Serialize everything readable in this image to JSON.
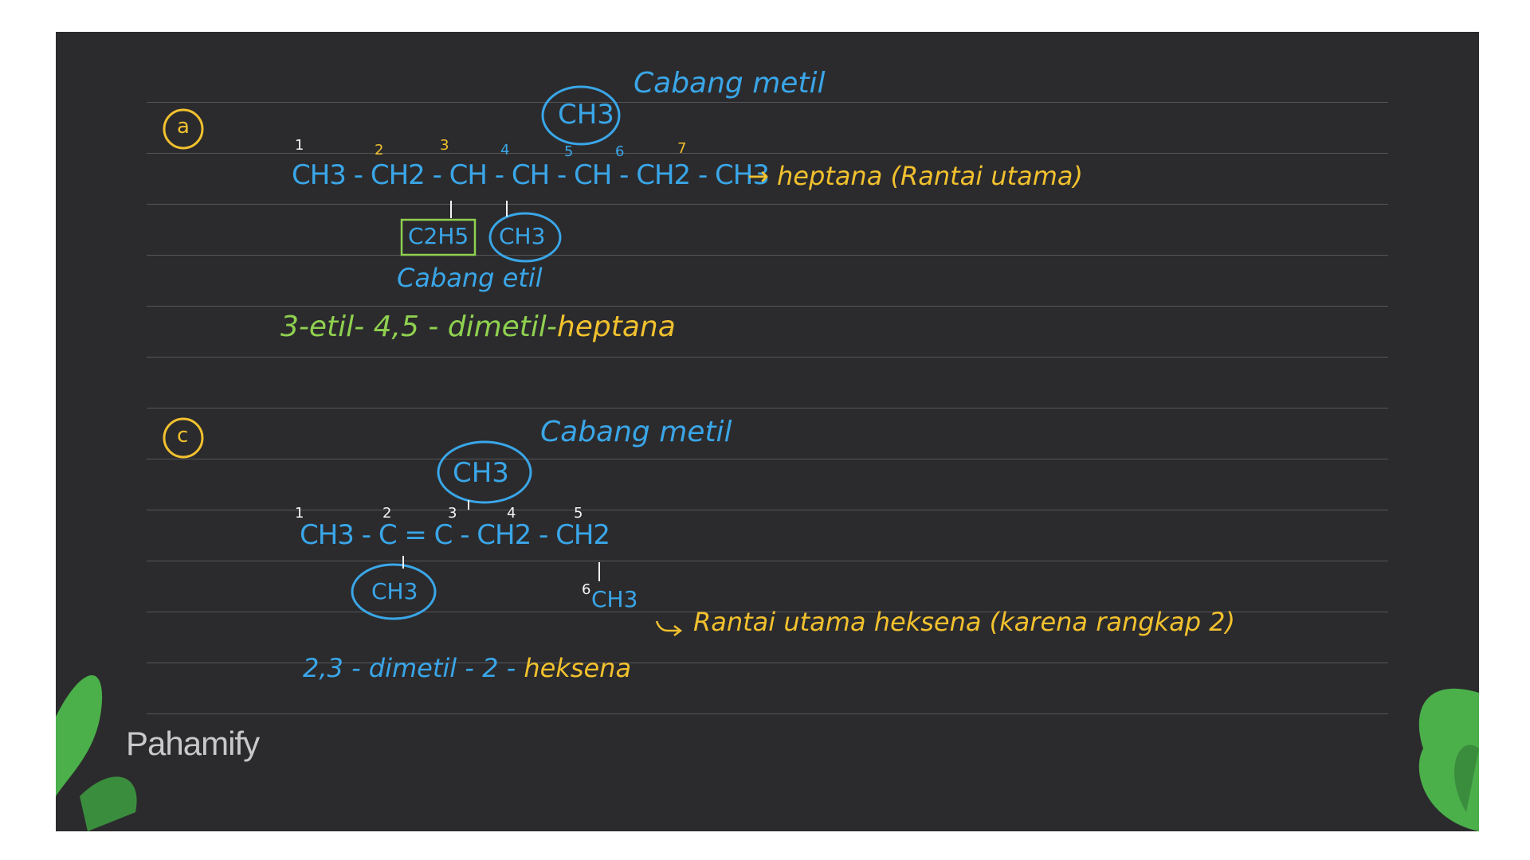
{
  "section_a": {
    "marker": "a",
    "label_metil": "Cabang metil",
    "branch_top": "CH3",
    "numbers": [
      "1",
      "2",
      "3",
      "4",
      "5",
      "6",
      "7"
    ],
    "main_chain": "CH3 - CH2 - CH - CH - CH - CH2 - CH3",
    "main_chain_note": "→ heptana (Rantai utama)",
    "branch_ethyl": "C2H5",
    "branch_methyl": "CH3",
    "label_etil": "Cabang etil",
    "name_prefix": "3-etil- 4,5 - dimetil-",
    "name_suffix": "heptana"
  },
  "section_c": {
    "marker": "c",
    "label_metil": "Cabang metil",
    "branch_top": "CH3",
    "numbers": [
      "1",
      "2",
      "3",
      "4",
      "5"
    ],
    "main_chain": "CH3 - C = C - CH2 - CH2",
    "branch_bottom": "CH3",
    "end_group": "CH3",
    "end_number": "6",
    "note": "Rantai utama heksena (karena rangkap 2)",
    "name_prefix": "2,3 - dimetil - 2 -",
    "name_suffix": "heksena"
  },
  "brand": {
    "logo": "Pahamify"
  },
  "colors": {
    "yellow": "#f2c12e",
    "blue": "#3aa6e8",
    "green": "#8fd14f",
    "board": "#2b2b2d"
  }
}
